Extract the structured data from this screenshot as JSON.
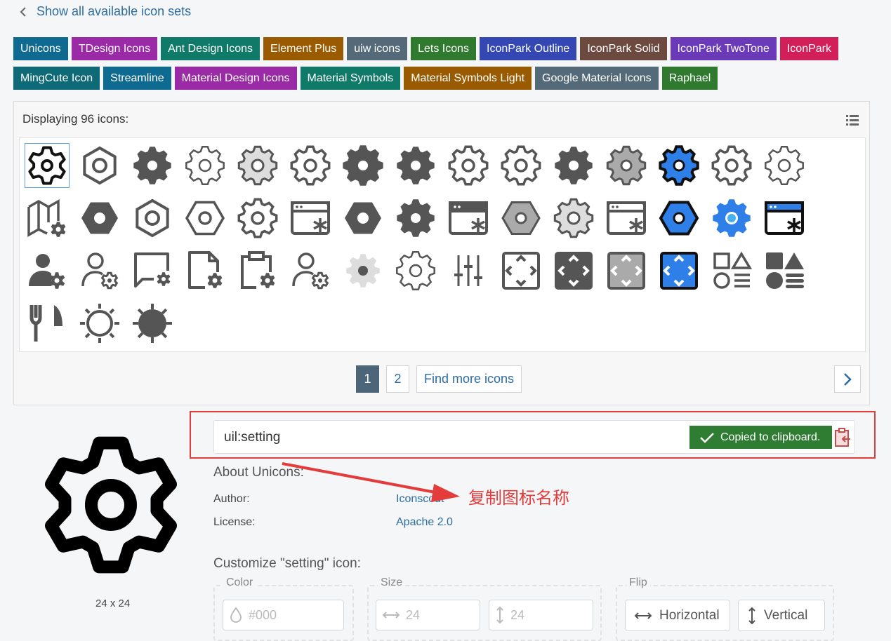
{
  "back_link": {
    "label": "Show all available icon sets",
    "icon": "chevron-left-icon"
  },
  "icon_sets_row1": [
    {
      "label": "Unicons",
      "color": "#0f6a92"
    },
    {
      "label": "TDesign Icons",
      "color": "#9b2aa6"
    },
    {
      "label": "Ant Design Icons",
      "color": "#0f7a68"
    },
    {
      "label": "Element Plus",
      "color": "#9a5a00"
    },
    {
      "label": "uiw icons",
      "color": "#546a78"
    },
    {
      "label": "Lets Icons",
      "color": "#2f7a2f"
    },
    {
      "label": "IconPark Outline",
      "color": "#3547b3"
    },
    {
      "label": "IconPark Solid",
      "color": "#6d4a3f"
    },
    {
      "label": "IconPark TwoTone",
      "color": "#6a3ab8"
    },
    {
      "label": "IconPark",
      "color": "#d21f5a"
    }
  ],
  "icon_sets_row2": [
    {
      "label": "MingCute Icon",
      "color": "#0f6a78"
    },
    {
      "label": "Streamline",
      "color": "#0f6a92"
    },
    {
      "label": "Material Design Icons",
      "color": "#9b2aa6"
    },
    {
      "label": "Material Symbols",
      "color": "#0f7a68"
    },
    {
      "label": "Material Symbols Light",
      "color": "#9a5a00"
    },
    {
      "label": "Google Material Icons",
      "color": "#546a78"
    },
    {
      "label": "Raphael",
      "color": "#2f7a2f"
    }
  ],
  "results": {
    "heading": "Displaying 96 icons:",
    "view_toggle_icon": "list-icon"
  },
  "icons": [
    "setting-outline-icon",
    "hexagon-nut-outline-icon",
    "gear-solid-icon",
    "gear-thin-icon",
    "gear-light-fill-icon",
    "gear-outline-icon",
    "gear-solid-large-icon",
    "gear-solid-icon",
    "gear-outline-icon",
    "gear-outline-icon",
    "gear-solid-icon",
    "gear-gray-fill-icon",
    "gear-blue-twotone-icon",
    "gear-outline-icon",
    "gear-thin-icon",
    "map-setting-icon",
    "hexagon-solid-icon",
    "hexagon-nut-outline-icon",
    "hexagon-outline-icon",
    "gear-outline-icon",
    "app-window-setting-icon",
    "hexagon-solid-icon",
    "gear-solid-icon",
    "app-window-setting-solid-icon",
    "hexagon-gray-fill-icon",
    "gear-light-fill-icon",
    "app-window-setting-icon",
    "hexagon-blue-icon",
    "gear-blue-icon",
    "app-window-setting-blue-icon",
    "user-setting-solid-icon",
    "user-setting-outline-icon",
    "message-setting-icon",
    "file-setting-icon",
    "clipboard-setting-icon",
    "user-setting-outline-icon",
    "gear-light-solid-icon",
    "gear-thin-icon",
    "sliders-icon",
    "move-frame-outline-icon",
    "move-frame-solid-icon",
    "move-frame-gray-icon",
    "move-frame-blue-icon",
    "category-outline-icon",
    "category-solid-icon",
    "fork-knife-icon",
    "sun-outline-icon",
    "sun-solid-icon"
  ],
  "pagination": {
    "pages": [
      "1",
      "2"
    ],
    "active": "1",
    "find_more": "Find more icons",
    "next_icon": "chevron-right-icon"
  },
  "preview": {
    "size_label": "24 x 24",
    "icon": "setting-outline-icon"
  },
  "icon_name": {
    "value": "uil:setting",
    "toast": "Copied to clipboard.",
    "toast_icon": "check-icon",
    "copy_icon": "copy-to-clipboard-icon"
  },
  "about": {
    "title": "About Unicons:",
    "author_label": "Author:",
    "author_value": "Iconscout",
    "license_label": "License:",
    "license_value": "Apache 2.0"
  },
  "annotation": {
    "text": "复制图标名称",
    "color": "#e43b3b"
  },
  "customize": {
    "title": "Customize \"setting\" icon:",
    "color_legend": "Color",
    "color_placeholder": "#000",
    "size_legend": "Size",
    "width_placeholder": "24",
    "height_placeholder": "24",
    "flip_legend": "Flip",
    "flip_horizontal": "Horizontal",
    "flip_vertical": "Vertical"
  },
  "accent_colors": {
    "link": "#2d6ca2",
    "active_page": "#4c6578",
    "success": "#2e7d32",
    "highlight": "#e43b3b"
  }
}
